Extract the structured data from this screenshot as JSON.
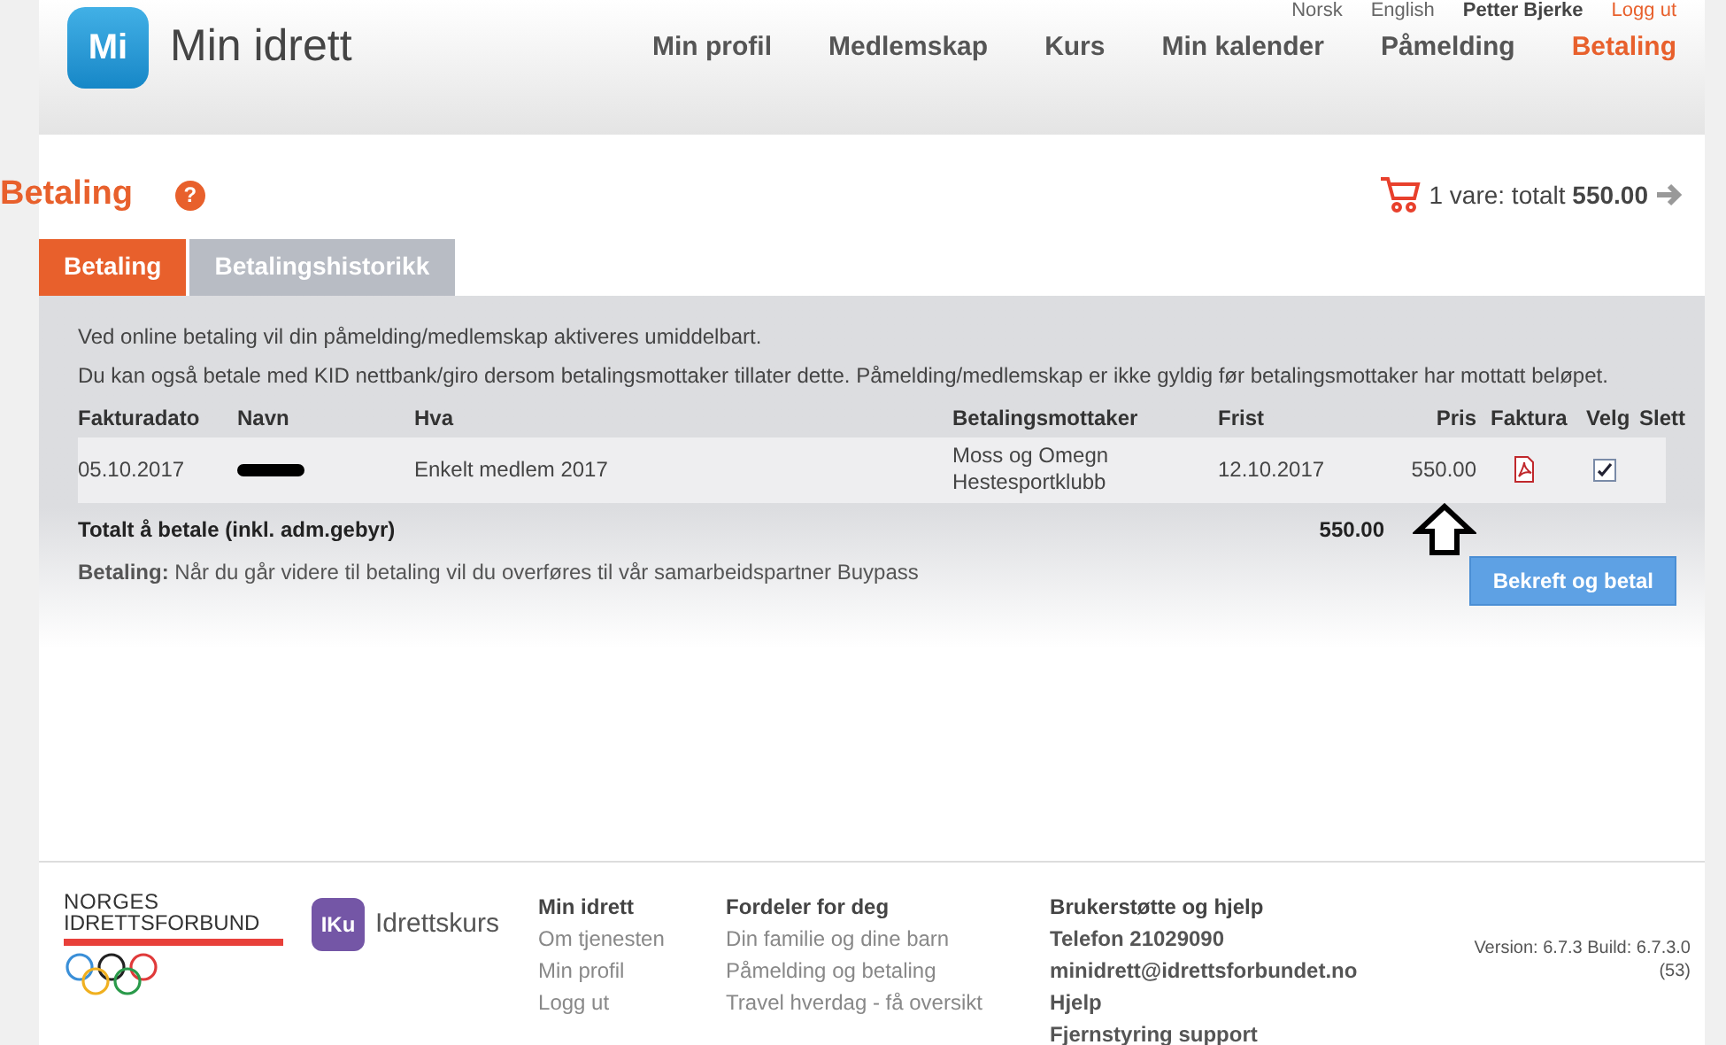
{
  "top_links": [
    {
      "label": "Norsk",
      "kind": "lang"
    },
    {
      "label": "English",
      "kind": "lang"
    },
    {
      "label": "Petter Bjerke",
      "kind": "user"
    },
    {
      "label": "Logg ut",
      "kind": "logout"
    }
  ],
  "logo": {
    "mark": "Mi",
    "name": "Min idrett"
  },
  "nav": [
    {
      "label": "Min profil",
      "selected": false
    },
    {
      "label": "Medlemskap",
      "selected": false
    },
    {
      "label": "Kurs",
      "selected": false
    },
    {
      "label": "Min kalender",
      "selected": false
    },
    {
      "label": "Påmelding",
      "selected": false
    },
    {
      "label": "Betaling",
      "selected": true
    }
  ],
  "page_title": "Betaling",
  "help": "?",
  "cart": {
    "text": "1 vare: totalt",
    "total": "550.00"
  },
  "tabs": [
    {
      "label": "Betaling",
      "selected": true
    },
    {
      "label": "Betalingshistorikk",
      "selected": false
    }
  ],
  "intro": [
    "Ved online betaling vil din påmelding/medlemskap aktiveres umiddelbart.",
    "Du kan også betale med KID nettbank/giro dersom betalingsmottaker tillater dette. Påmelding/medlemskap er ikke gyldig før betalingsmottaker har mottatt beløpet."
  ],
  "table": {
    "columns": [
      "Fakturadato",
      "Navn",
      "Hva",
      "Betalingsmottaker",
      "Frist",
      "Pris",
      "Faktura",
      "Velg",
      "Slett"
    ],
    "rows": [
      {
        "date": "05.10.2017",
        "what": "Enkelt medlem 2017",
        "recipient": "Moss og Omegn Hestesportklubb",
        "due": "12.10.2017",
        "price": "550.00",
        "checked": true
      }
    ],
    "total_label": "Totalt å betale (inkl. adm.gebyr)",
    "total": "550.00"
  },
  "note": "**Betaling:** Når du går videre til betaling vil du overføres til vår samarbeidspartner Buypass",
  "confirm_button": "Bekreft og betal",
  "footer": {
    "org": [
      "NORGES",
      "IDRETTSFORBUND"
    ],
    "kurs": {
      "mark": "IKu",
      "name": "Idrettskurs"
    },
    "columns": [
      {
        "title": "Min idrett",
        "links": [
          "Om tjenesten",
          "Min profil",
          "Logg ut"
        ]
      },
      {
        "title": "Fordeler for deg",
        "links": [
          "Din familie og dine barn",
          "Påmelding og betaling",
          "Travel hverdag - få oversikt"
        ]
      },
      {
        "title": "Brukerstøtte og hjelp",
        "links": [
          "Telefon 21029090",
          "minidrett@idrettsforbundet.no",
          "Hjelp",
          "Fjernstyring support"
        ]
      }
    ],
    "version": [
      "Version: 6.7.3 Build: 6.7.3.0",
      "(53)"
    ]
  }
}
